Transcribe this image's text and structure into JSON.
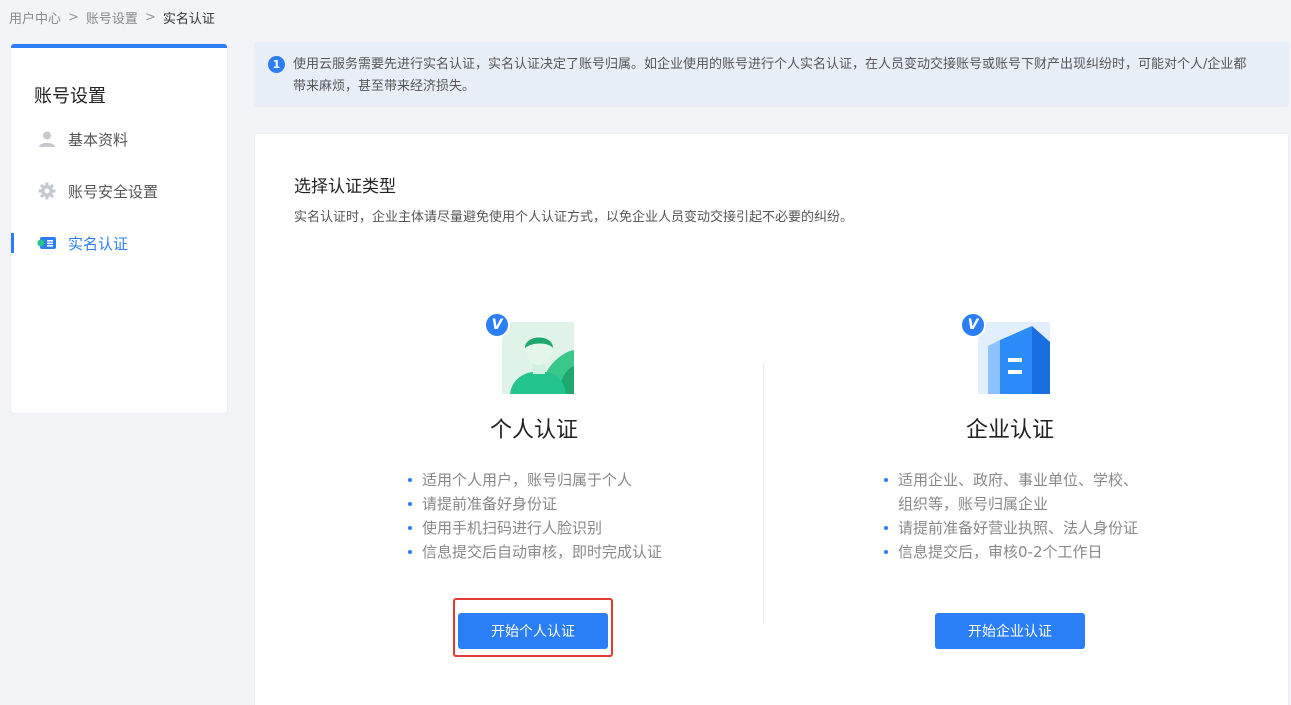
{
  "breadcrumb": {
    "items": [
      "用户中心",
      "账号设置",
      "实名认证"
    ],
    "separator_icon": "chevron-right-icon"
  },
  "sidebar": {
    "title": "账号设置",
    "items": [
      {
        "label": "基本资料",
        "icon": "user-icon",
        "active": false
      },
      {
        "label": "账号安全设置",
        "icon": "gear-icon",
        "active": false
      },
      {
        "label": "实名认证",
        "icon": "id-card-icon",
        "active": true
      }
    ],
    "accent_color": "#2b7ff6"
  },
  "notice": {
    "icon": "info-icon",
    "icon_text": "1",
    "text": "使用云服务需要先进行实名认证，实名认证决定了账号归属。如企业使用的账号进行个人实名认证，在人员变动交接账号或账号下财产出现纠纷时，可能对个人/企业都带来麻烦，甚至带来经济损失。"
  },
  "main": {
    "heading": "选择认证类型",
    "subheading": "实名认证时，企业主体请尽量避免使用个人认证方式，以免企业人员变动交接引起不必要的纠纷。",
    "personal": {
      "badge": "V",
      "name": "个人认证",
      "bullets": [
        "适用个人用户，账号归属于个人",
        "请提前准备好身份证",
        "使用手机扫码进行人脸识别",
        "信息提交后自动审核，即时完成认证"
      ],
      "button_label": "开始个人认证",
      "illustration": "person-avatar-icon",
      "highlight_color": "#e53935"
    },
    "enterprise": {
      "badge": "V",
      "name": "企业认证",
      "bullets": [
        "适用企业、政府、事业单位、学校、",
        "组织等，账号归属企业",
        "请提前准备好营业执照、法人身份证",
        "信息提交后，审核0-2个工作日"
      ],
      "button_label": "开始企业认证",
      "illustration": "building-icon"
    }
  }
}
